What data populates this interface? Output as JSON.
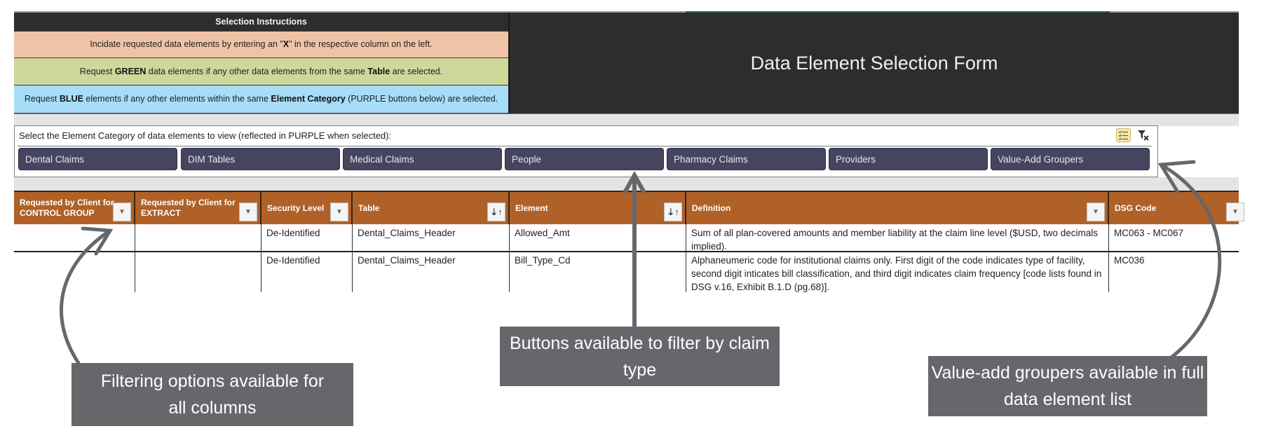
{
  "form_title": "Data Element Selection Form",
  "instructions": {
    "header": "Selection Instructions",
    "line1": {
      "pre": "Incidate requested data elements by entering an \"",
      "bold": "X",
      "post": "\" in the respective column on the left."
    },
    "line2": {
      "pre": "Request ",
      "bold1": "GREEN",
      "mid": " data elements if any other data elements from the same ",
      "bold2": "Table",
      "post": " are selected."
    },
    "line3": {
      "pre": "Request ",
      "bold1": "BLUE",
      "mid": " elements if any other elements within the same ",
      "bold2": "Element Category",
      "post": " (PURPLE buttons below) are selected."
    },
    "colors": {
      "header": "#2d2d2d",
      "peach": "#efc4a6",
      "green": "#cfd79b",
      "blue": "#a7ddf8"
    }
  },
  "slicer": {
    "caption": "Select the Element Category of data elements to view (reflected in PURPLE when selected):",
    "multi_select_icon": "multi-select-icon",
    "clear_filter_icon": "clear-filter-icon",
    "button_color": "#454560",
    "buttons": [
      {
        "label": "Dental Claims"
      },
      {
        "label": "DIM Tables"
      },
      {
        "label": "Medical Claims"
      },
      {
        "label": "People"
      },
      {
        "label": "Pharmacy Claims"
      },
      {
        "label": "Providers"
      },
      {
        "label": "Value-Add Groupers"
      }
    ]
  },
  "table": {
    "header_color": "#b06127",
    "columns": [
      {
        "label": "Requested by Client for CONTROL GROUP",
        "filter": "dropdown"
      },
      {
        "label": "Requested by Client for EXTRACT",
        "filter": "dropdown"
      },
      {
        "label": "Security Level",
        "filter": "dropdown"
      },
      {
        "label": "Table",
        "filter": "sorted-ascending"
      },
      {
        "label": "Element",
        "filter": "sorted-ascending"
      },
      {
        "label": "Definition",
        "filter": "dropdown"
      },
      {
        "label": "DSG Code",
        "filter": "dropdown"
      }
    ],
    "rows": [
      {
        "control_group": "",
        "extract": "",
        "security_level": "De-Identified",
        "table": "Dental_Claims_Header",
        "element": "Allowed_Amt",
        "definition": "Sum of all plan-covered amounts and member liability at the claim line level ($USD, two decimals implied).",
        "dsg_code": "MC063 - MC067"
      },
      {
        "control_group": "",
        "extract": "",
        "security_level": "De-Identified",
        "table": "Dental_Claims_Header",
        "element": "Bill_Type_Cd",
        "definition": "Alphaneumeric code for institutional claims only. First digit of the code indicates type of facility, second digit inticates bill classification, and third digit indicates claim frequency [code lists found in DSG v.16, Exhibit B.1.D (pg.68)].",
        "dsg_code": "MC036"
      }
    ]
  },
  "annotations": {
    "color": "#66676b",
    "filtering": "Filtering options available for all columns",
    "buttons": "Buttons available to filter by claim type",
    "groupers": "Value-add groupers available in full data element list"
  }
}
